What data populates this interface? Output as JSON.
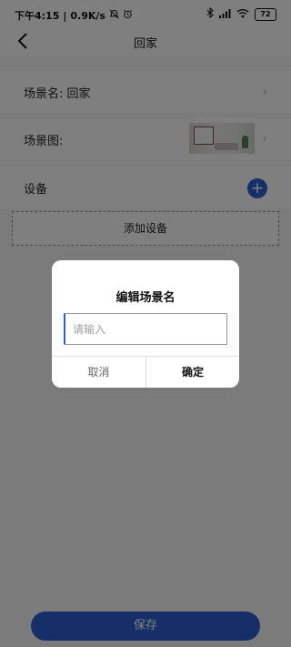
{
  "status_bar": {
    "time": "下午4:15",
    "network_speed": "0.9K/s",
    "separator": "|",
    "battery": "72",
    "icons": [
      "mute-icon",
      "alarm-icon",
      "bluetooth-icon",
      "signal-icon",
      "wifi-icon",
      "battery-icon"
    ]
  },
  "header": {
    "title": "回家"
  },
  "scene_name": {
    "label": "场景名: 回家"
  },
  "scene_image": {
    "label": "场景图:"
  },
  "devices": {
    "label": "设备",
    "add_icon": "+",
    "add_device_label": "添加设备"
  },
  "save_label": "保存",
  "dialog": {
    "title": "编辑场景名",
    "input_value": "",
    "input_placeholder": "请输入",
    "cancel_label": "取消",
    "confirm_label": "确定"
  },
  "colors": {
    "accent": "#2f5fd0",
    "overlay": "rgba(0,0,0,0.5)"
  }
}
